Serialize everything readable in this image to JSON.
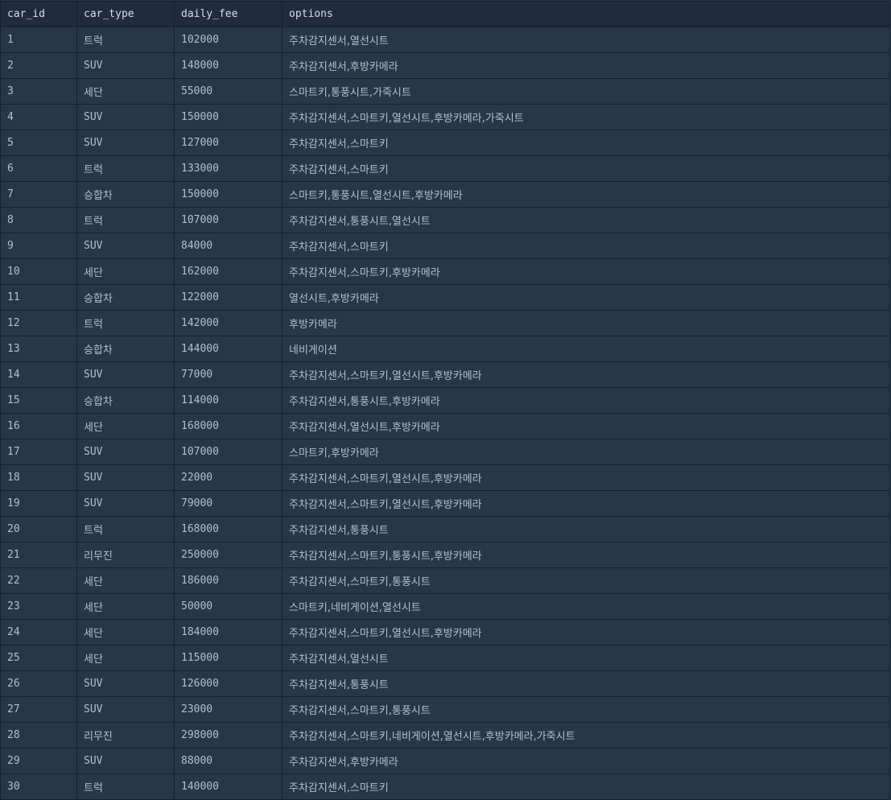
{
  "table": {
    "columns": [
      "car_id",
      "car_type",
      "daily_fee",
      "options"
    ],
    "rows": [
      {
        "car_id": "1",
        "car_type": "트럭",
        "daily_fee": "102000",
        "options": "주차감지센서,열선시트"
      },
      {
        "car_id": "2",
        "car_type": "SUV",
        "daily_fee": "148000",
        "options": "주차감지센서,후방카메라"
      },
      {
        "car_id": "3",
        "car_type": "세단",
        "daily_fee": "55000",
        "options": "스마트키,통풍시트,가죽시트"
      },
      {
        "car_id": "4",
        "car_type": "SUV",
        "daily_fee": "150000",
        "options": "주차감지센서,스마트키,열선시트,후방카메라,가죽시트"
      },
      {
        "car_id": "5",
        "car_type": "SUV",
        "daily_fee": "127000",
        "options": "주차감지센서,스마트키"
      },
      {
        "car_id": "6",
        "car_type": "트럭",
        "daily_fee": "133000",
        "options": "주차감지센서,스마트키"
      },
      {
        "car_id": "7",
        "car_type": "승합차",
        "daily_fee": "150000",
        "options": "스마트키,통풍시트,열선시트,후방카메라"
      },
      {
        "car_id": "8",
        "car_type": "트럭",
        "daily_fee": "107000",
        "options": "주차감지센서,통풍시트,열선시트"
      },
      {
        "car_id": "9",
        "car_type": "SUV",
        "daily_fee": "84000",
        "options": "주차감지센서,스마트키"
      },
      {
        "car_id": "10",
        "car_type": "세단",
        "daily_fee": "162000",
        "options": "주차감지센서,스마트키,후방카메라"
      },
      {
        "car_id": "11",
        "car_type": "승합차",
        "daily_fee": "122000",
        "options": "열선시트,후방카메라"
      },
      {
        "car_id": "12",
        "car_type": "트럭",
        "daily_fee": "142000",
        "options": "후방카메라"
      },
      {
        "car_id": "13",
        "car_type": "승합차",
        "daily_fee": "144000",
        "options": "네비게이션"
      },
      {
        "car_id": "14",
        "car_type": "SUV",
        "daily_fee": "77000",
        "options": "주차감지센서,스마트키,열선시트,후방카메라"
      },
      {
        "car_id": "15",
        "car_type": "승합차",
        "daily_fee": "114000",
        "options": "주차감지센서,통풍시트,후방카메라"
      },
      {
        "car_id": "16",
        "car_type": "세단",
        "daily_fee": "168000",
        "options": "주차감지센서,열선시트,후방카메라"
      },
      {
        "car_id": "17",
        "car_type": "SUV",
        "daily_fee": "107000",
        "options": "스마트키,후방카메라"
      },
      {
        "car_id": "18",
        "car_type": "SUV",
        "daily_fee": "22000",
        "options": "주차감지센서,스마트키,열선시트,후방카메라"
      },
      {
        "car_id": "19",
        "car_type": "SUV",
        "daily_fee": "79000",
        "options": "주차감지센서,스마트키,열선시트,후방카메라"
      },
      {
        "car_id": "20",
        "car_type": "트럭",
        "daily_fee": "168000",
        "options": "주차감지센서,통풍시트"
      },
      {
        "car_id": "21",
        "car_type": "리무진",
        "daily_fee": "250000",
        "options": "주차감지센서,스마트키,통풍시트,후방카메라"
      },
      {
        "car_id": "22",
        "car_type": "세단",
        "daily_fee": "186000",
        "options": "주차감지센서,스마트키,통풍시트"
      },
      {
        "car_id": "23",
        "car_type": "세단",
        "daily_fee": "50000",
        "options": "스마트키,네비게이션,열선시트"
      },
      {
        "car_id": "24",
        "car_type": "세단",
        "daily_fee": "184000",
        "options": "주차감지센서,스마트키,열선시트,후방카메라"
      },
      {
        "car_id": "25",
        "car_type": "세단",
        "daily_fee": "115000",
        "options": "주차감지센서,열선시트"
      },
      {
        "car_id": "26",
        "car_type": "SUV",
        "daily_fee": "126000",
        "options": "주차감지센서,통풍시트"
      },
      {
        "car_id": "27",
        "car_type": "SUV",
        "daily_fee": "23000",
        "options": "주차감지센서,스마트키,통풍시트"
      },
      {
        "car_id": "28",
        "car_type": "리무진",
        "daily_fee": "298000",
        "options": "주차감지센서,스마트키,네비게이션,열선시트,후방카메라,가죽시트"
      },
      {
        "car_id": "29",
        "car_type": "SUV",
        "daily_fee": "88000",
        "options": "주차감지센서,후방카메라"
      },
      {
        "car_id": "30",
        "car_type": "트럭",
        "daily_fee": "140000",
        "options": "주차감지센서,스마트키"
      }
    ]
  }
}
